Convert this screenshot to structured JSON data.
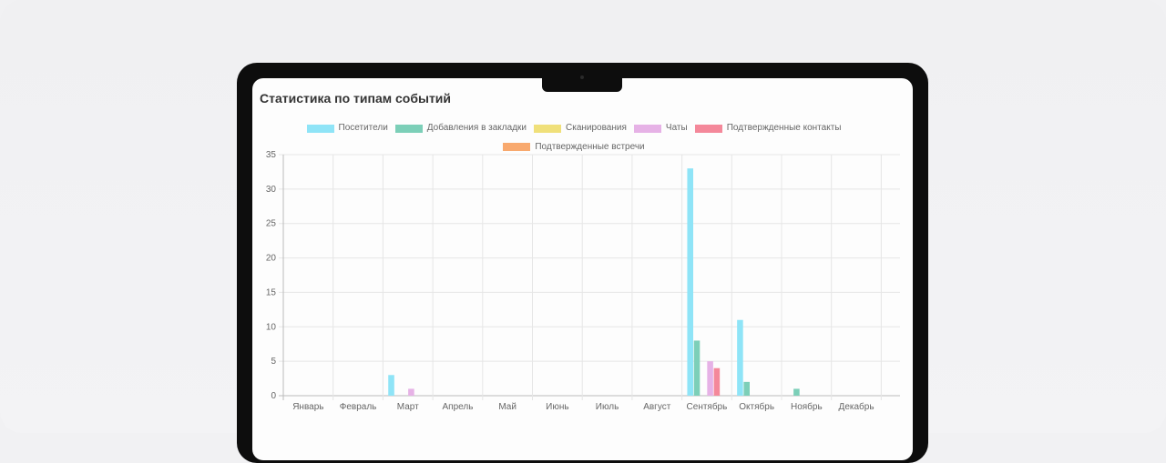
{
  "title": "Статистика по типам событий",
  "chart_data": {
    "type": "bar",
    "title": "Статистика по типам событий",
    "categories": [
      "Январь",
      "Февраль",
      "Март",
      "Апрель",
      "Май",
      "Июнь",
      "Июль",
      "Август",
      "Сентябрь",
      "Октябрь",
      "Ноябрь",
      "Декабрь"
    ],
    "yticks": [
      "0",
      "5",
      "10",
      "15",
      "20",
      "25",
      "30",
      "35"
    ],
    "ylim": [
      0,
      35
    ],
    "grid": true,
    "legend_position": "top",
    "series": [
      {
        "name": "Посетители",
        "color": "#8fe4f7",
        "values": [
          0,
          0,
          3,
          0,
          0,
          0,
          0,
          0,
          33,
          11,
          0,
          0
        ]
      },
      {
        "name": "Добавления в закладки",
        "color": "#7ccfb8",
        "values": [
          0,
          0,
          0,
          0,
          0,
          0,
          0,
          0,
          8,
          2,
          1,
          0
        ]
      },
      {
        "name": "Сканирования",
        "color": "#f0e07a",
        "values": [
          0,
          0,
          0,
          0,
          0,
          0,
          0,
          0,
          0,
          0,
          0,
          0
        ]
      },
      {
        "name": "Чаты",
        "color": "#e6b2e6",
        "values": [
          0,
          0,
          1,
          0,
          0,
          0,
          0,
          0,
          5,
          0,
          0,
          0
        ]
      },
      {
        "name": "Подтвержденные контакты",
        "color": "#f4889a",
        "values": [
          0,
          0,
          0,
          0,
          0,
          0,
          0,
          0,
          4,
          0,
          0,
          0
        ]
      },
      {
        "name": "Подтвержденные встречи",
        "color": "#f8a96e",
        "values": [
          0,
          0,
          0,
          0,
          0,
          0,
          0,
          0,
          0,
          0,
          0,
          0
        ]
      }
    ]
  }
}
